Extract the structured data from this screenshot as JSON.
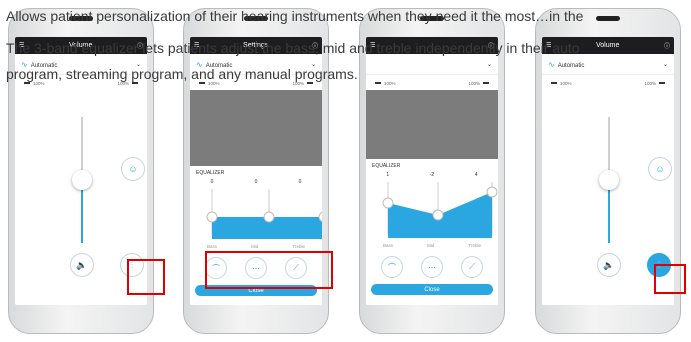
{
  "caption": {
    "line1": "Allows patient personalization of their hearing instruments when they need it the most…in the",
    "line2": "The 3-band equalizer lets patients adjust the bass, mid and treble independently in their auto",
    "line3": "program, streaming program, and any manual programs."
  },
  "colors": {
    "accent": "#2aa6e0",
    "highlight": "#e00000",
    "topbar": "#1d1d1f"
  },
  "phones": [
    {
      "title": "Volume",
      "program": "Automatic",
      "vol_left": "100%",
      "vol_right": "100%",
      "volume_fraction": 0.5
    },
    {
      "title": "Settings",
      "program": "Automatic",
      "vol_left": "100%",
      "vol_right": "100%",
      "equalizer": {
        "title": "EQUALIZER",
        "values": [
          "0",
          "0",
          "0"
        ],
        "labels": [
          "Bass",
          "Mid",
          "Treble"
        ],
        "close": "Close"
      }
    },
    {
      "vol_left": "100%",
      "vol_right": "100%",
      "equalizer": {
        "title": "EQUALIZER",
        "values": [
          "1",
          "-2",
          "4"
        ],
        "labels": [
          "Bass",
          "Mid",
          "Treble"
        ],
        "close": "Close"
      }
    },
    {
      "title": "Volume",
      "program": "Automatic",
      "vol_left": "100%",
      "vol_right": "100%",
      "volume_fraction": 0.5
    }
  ]
}
